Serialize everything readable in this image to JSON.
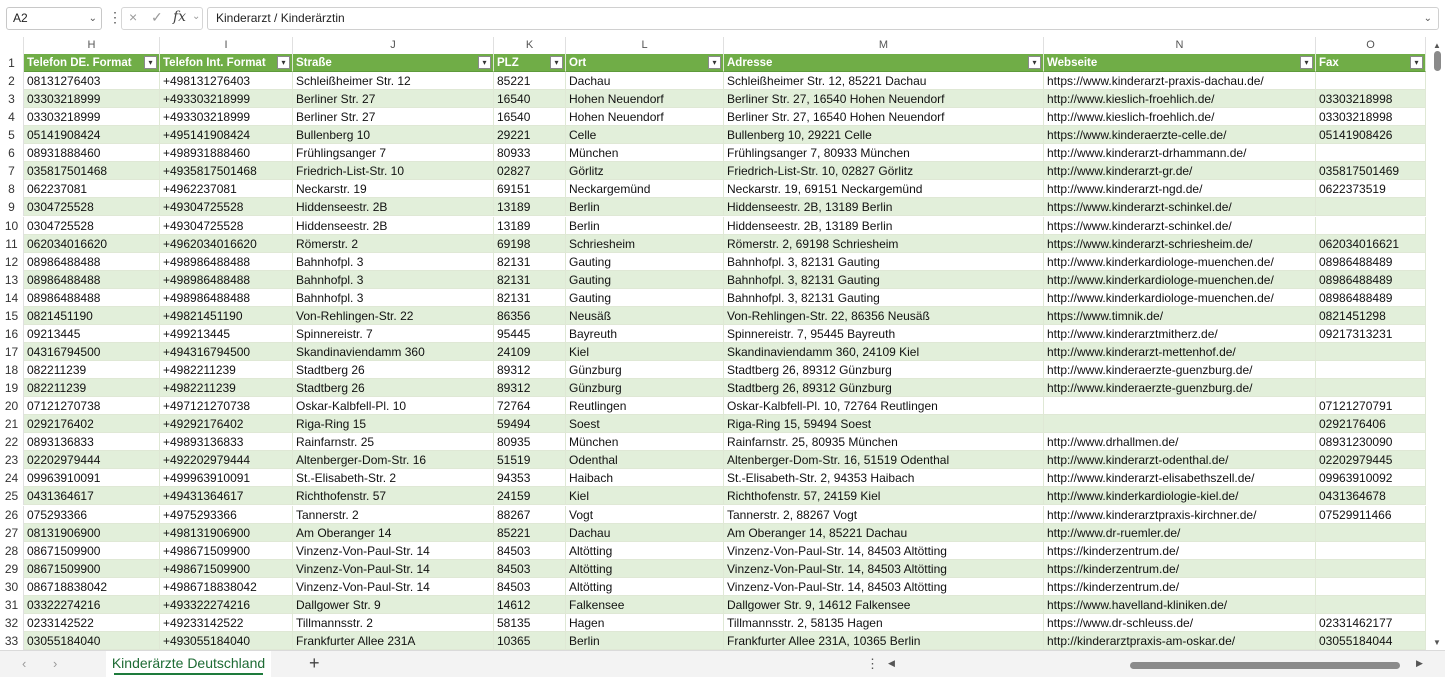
{
  "formula_bar": {
    "name_box": "A2",
    "cancel_icon": "×",
    "enter_icon": "✓",
    "fx_label": "fx",
    "formula": "Kinderarzt / Kinderärztin"
  },
  "columns": [
    "H",
    "I",
    "J",
    "K",
    "L",
    "M",
    "N",
    "O"
  ],
  "headers": [
    "Telefon DE. Format",
    "Telefon Int. Format",
    "Straße",
    "PLZ",
    "Ort",
    "Adresse",
    "Webseite",
    "Fax"
  ],
  "row_numbers": [
    1,
    2,
    3,
    4,
    5,
    6,
    7,
    8,
    9,
    10,
    11,
    12,
    13,
    14,
    15,
    16,
    17,
    18,
    19,
    20,
    21,
    22,
    23,
    24,
    25,
    26,
    27,
    28,
    29,
    30,
    31,
    32,
    33
  ],
  "rows": [
    [
      "08131276403",
      "+498131276403",
      "Schleißheimer Str. 12",
      "85221",
      "Dachau",
      "Schleißheimer Str. 12, 85221 Dachau",
      "https://www.kinderarzt-praxis-dachau.de/",
      ""
    ],
    [
      "03303218999",
      "+493303218999",
      "Berliner Str. 27",
      "16540",
      "Hohen Neuendorf",
      "Berliner Str. 27, 16540 Hohen Neuendorf",
      "http://www.kieslich-froehlich.de/",
      "03303218998"
    ],
    [
      "03303218999",
      "+493303218999",
      "Berliner Str. 27",
      "16540",
      "Hohen Neuendorf",
      "Berliner Str. 27, 16540 Hohen Neuendorf",
      "http://www.kieslich-froehlich.de/",
      "03303218998"
    ],
    [
      "05141908424",
      "+495141908424",
      "Bullenberg 10",
      "29221",
      "Celle",
      "Bullenberg 10, 29221 Celle",
      "https://www.kinderaerzte-celle.de/",
      "05141908426"
    ],
    [
      "08931888460",
      "+498931888460",
      "Frühlingsanger 7",
      "80933",
      "München",
      "Frühlingsanger 7, 80933 München",
      "http://www.kinderarzt-drhammann.de/",
      ""
    ],
    [
      "035817501468",
      "+4935817501468",
      "Friedrich-List-Str. 10",
      "02827",
      "Görlitz",
      "Friedrich-List-Str. 10, 02827 Görlitz",
      "http://www.kinderarzt-gr.de/",
      "035817501469"
    ],
    [
      "062237081",
      "+4962237081",
      "Neckarstr. 19",
      "69151",
      "Neckargemünd",
      "Neckarstr. 19, 69151 Neckargemünd",
      "http://www.kinderarzt-ngd.de/",
      "0622373519"
    ],
    [
      "0304725528",
      "+49304725528",
      "Hiddenseestr. 2B",
      "13189",
      "Berlin",
      "Hiddenseestr. 2B, 13189 Berlin",
      "https://www.kinderarzt-schinkel.de/",
      ""
    ],
    [
      "0304725528",
      "+49304725528",
      "Hiddenseestr. 2B",
      "13189",
      "Berlin",
      "Hiddenseestr. 2B, 13189 Berlin",
      "https://www.kinderarzt-schinkel.de/",
      ""
    ],
    [
      "062034016620",
      "+4962034016620",
      "Römerstr. 2",
      "69198",
      "Schriesheim",
      "Römerstr. 2, 69198 Schriesheim",
      "https://www.kinderarzt-schriesheim.de/",
      "062034016621"
    ],
    [
      "08986488488",
      "+498986488488",
      "Bahnhofpl. 3",
      "82131",
      "Gauting",
      "Bahnhofpl. 3, 82131 Gauting",
      "http://www.kinderkardiologe-muenchen.de/",
      "08986488489"
    ],
    [
      "08986488488",
      "+498986488488",
      "Bahnhofpl. 3",
      "82131",
      "Gauting",
      "Bahnhofpl. 3, 82131 Gauting",
      "http://www.kinderkardiologe-muenchen.de/",
      "08986488489"
    ],
    [
      "08986488488",
      "+498986488488",
      "Bahnhofpl. 3",
      "82131",
      "Gauting",
      "Bahnhofpl. 3, 82131 Gauting",
      "http://www.kinderkardiologe-muenchen.de/",
      "08986488489"
    ],
    [
      "0821451190",
      "+49821451190",
      "Von-Rehlingen-Str. 22",
      "86356",
      "Neusäß",
      "Von-Rehlingen-Str. 22, 86356 Neusäß",
      "https://www.timnik.de/",
      "0821451298"
    ],
    [
      "09213445",
      "+499213445",
      "Spinnereistr. 7",
      "95445",
      "Bayreuth",
      "Spinnereistr. 7, 95445 Bayreuth",
      "http://www.kinderarztmitherz.de/",
      "09217313231"
    ],
    [
      "04316794500",
      "+494316794500",
      "Skandinaviendamm 360",
      "24109",
      "Kiel",
      "Skandinaviendamm 360, 24109 Kiel",
      "http://www.kinderarzt-mettenhof.de/",
      ""
    ],
    [
      "082211239",
      "+4982211239",
      "Stadtberg 26",
      "89312",
      "Günzburg",
      "Stadtberg 26, 89312 Günzburg",
      "http://www.kinderaerzte-guenzburg.de/",
      ""
    ],
    [
      "082211239",
      "+4982211239",
      "Stadtberg 26",
      "89312",
      "Günzburg",
      "Stadtberg 26, 89312 Günzburg",
      "http://www.kinderaerzte-guenzburg.de/",
      ""
    ],
    [
      "07121270738",
      "+497121270738",
      "Oskar-Kalbfell-Pl. 10",
      "72764",
      "Reutlingen",
      "Oskar-Kalbfell-Pl. 10, 72764 Reutlingen",
      "",
      "07121270791"
    ],
    [
      "0292176402",
      "+49292176402",
      "Riga-Ring 15",
      "59494",
      "Soest",
      "Riga-Ring 15, 59494 Soest",
      "",
      "0292176406"
    ],
    [
      "0893136833",
      "+49893136833",
      "Rainfarnstr. 25",
      "80935",
      "München",
      "Rainfarnstr. 25, 80935 München",
      "http://www.drhallmen.de/",
      "08931230090"
    ],
    [
      "02202979444",
      "+492202979444",
      "Altenberger-Dom-Str. 16",
      "51519",
      "Odenthal",
      "Altenberger-Dom-Str. 16, 51519 Odenthal",
      "http://www.kinderarzt-odenthal.de/",
      "02202979445"
    ],
    [
      "09963910091",
      "+499963910091",
      "St.-Elisabeth-Str. 2",
      "94353",
      "Haibach",
      "St.-Elisabeth-Str. 2, 94353 Haibach",
      "http://www.kinderarzt-elisabethszell.de/",
      "09963910092"
    ],
    [
      "0431364617",
      "+49431364617",
      "Richthofenstr. 57",
      "24159",
      "Kiel",
      "Richthofenstr. 57, 24159 Kiel",
      "http://www.kinderkardiologie-kiel.de/",
      "0431364678"
    ],
    [
      "075293366",
      "+4975293366",
      "Tannerstr. 2",
      "88267",
      "Vogt",
      "Tannerstr. 2, 88267 Vogt",
      "http://www.kinderarztpraxis-kirchner.de/",
      "07529911466"
    ],
    [
      "08131906900",
      "+498131906900",
      "Am Oberanger 14",
      "85221",
      "Dachau",
      "Am Oberanger 14, 85221 Dachau",
      "http://www.dr-ruemler.de/",
      ""
    ],
    [
      "08671509900",
      "+498671509900",
      "Vinzenz-Von-Paul-Str. 14",
      "84503",
      "Altötting",
      "Vinzenz-Von-Paul-Str. 14, 84503 Altötting",
      "https://kinderzentrum.de/",
      ""
    ],
    [
      "08671509900",
      "+498671509900",
      "Vinzenz-Von-Paul-Str. 14",
      "84503",
      "Altötting",
      "Vinzenz-Von-Paul-Str. 14, 84503 Altötting",
      "https://kinderzentrum.de/",
      ""
    ],
    [
      "086718838042",
      "+4986718838042",
      "Vinzenz-Von-Paul-Str. 14",
      "84503",
      "Altötting",
      "Vinzenz-Von-Paul-Str. 14, 84503 Altötting",
      "https://kinderzentrum.de/",
      ""
    ],
    [
      "03322274216",
      "+493322274216",
      "Dallgower Str. 9",
      "14612",
      "Falkensee",
      "Dallgower Str. 9, 14612 Falkensee",
      "https://www.havelland-kliniken.de/",
      ""
    ],
    [
      "0233142522",
      "+49233142522",
      "Tillmannsstr. 2",
      "58135",
      "Hagen",
      "Tillmannsstr. 2, 58135 Hagen",
      "https://www.dr-schleuss.de/",
      "02331462177"
    ],
    [
      "03055184040",
      "+493055184040",
      "Frankfurter Allee 231A",
      "10365",
      "Berlin",
      "Frankfurter Allee 231A, 10365 Berlin",
      "http://kinderarztpraxis-am-oskar.de/",
      "03055184044"
    ]
  ],
  "sheet_tabs": [
    "Kinderärzte Deutschland"
  ],
  "add_sheet_label": "+",
  "colors": {
    "header_green": "#70ad47",
    "band_green": "#e2efda",
    "tab_text": "#1e6b34"
  }
}
